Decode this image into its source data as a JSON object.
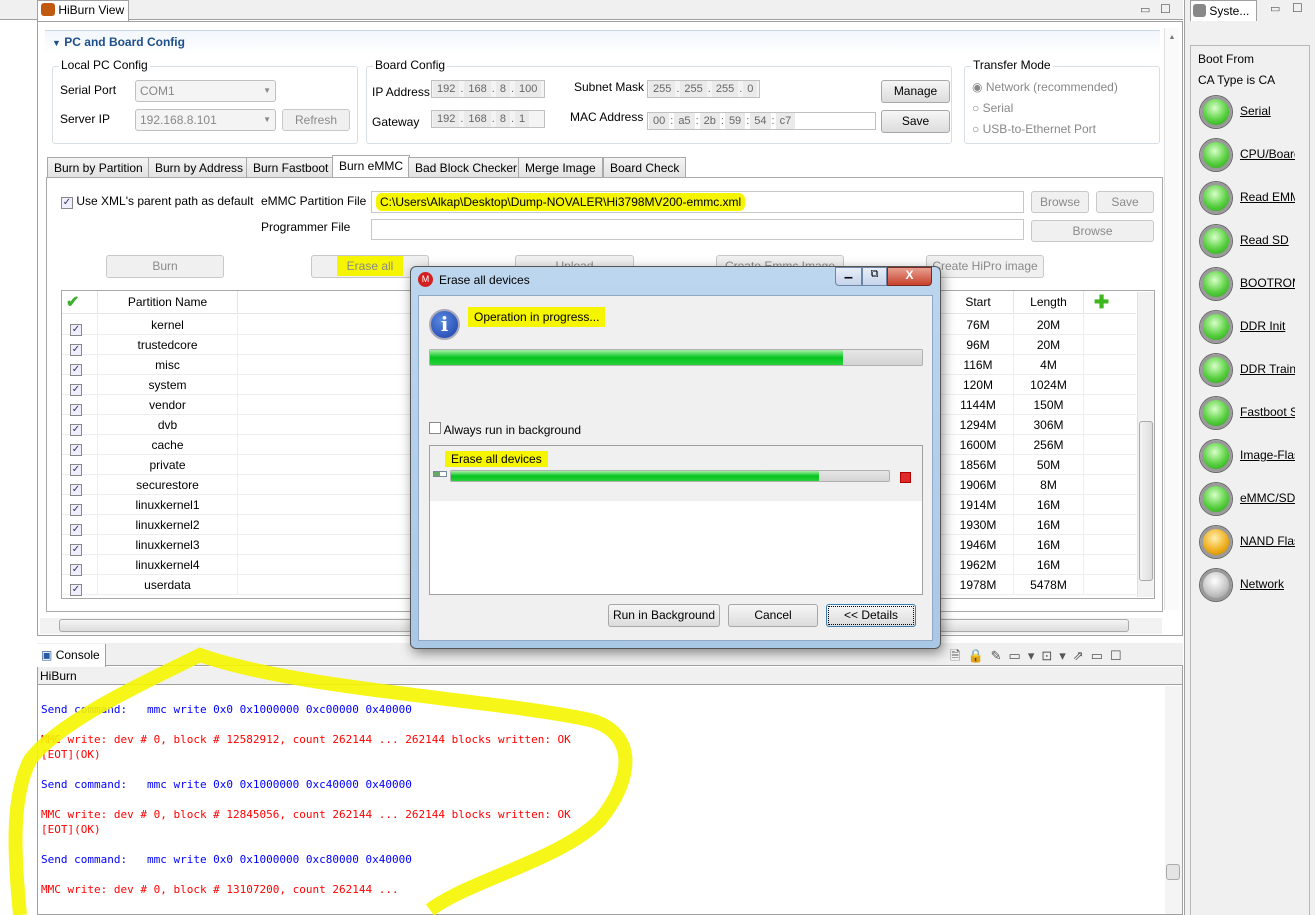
{
  "view_tab": {
    "title": "HiBurn View"
  },
  "section": {
    "title": "PC and Board Config"
  },
  "local_pc": {
    "title": "Local PC Config",
    "serial_port_label": "Serial Port",
    "serial_port_value": "COM1",
    "server_ip_label": "Server IP",
    "server_ip_value": "192.168.8.101",
    "refresh": "Refresh"
  },
  "board": {
    "title": "Board Config",
    "ip_label": "IP Address",
    "ip": [
      "192",
      "168",
      "8",
      "100"
    ],
    "gateway_label": "Gateway",
    "gateway": [
      "192",
      "168",
      "8",
      "1"
    ],
    "subnet_label": "Subnet Mask",
    "subnet": [
      "255",
      "255",
      "255",
      "0"
    ],
    "mac_label": "MAC Address",
    "mac": [
      "00",
      "a5",
      "2b",
      "59",
      "54",
      "c7"
    ],
    "manage": "Manage",
    "save": "Save"
  },
  "transfer": {
    "title": "Transfer Mode",
    "options": [
      "Network (recommended)",
      "Serial",
      "USB-to-Ethernet Port"
    ],
    "selected": 0
  },
  "tabs": [
    "Burn by Partition",
    "Burn by Address",
    "Burn Fastboot",
    "Burn eMMC",
    "Bad Block Checker",
    "Merge Image",
    "Board Check"
  ],
  "active_tab": "Burn eMMC",
  "emmc": {
    "use_parent_label": "Use XML's parent path as default",
    "use_parent_checked": true,
    "partition_file_label": "eMMC Partition File",
    "partition_file": "C:\\Users\\Alkap\\Desktop\\Dump-NOVALER\\Hi3798MV200-emmc.xml",
    "programmer_label": "Programmer File",
    "programmer_file": "",
    "browse": "Browse",
    "save": "Save",
    "burn": "Burn",
    "erase_all": "Erase all",
    "upload": "Upload",
    "create_emmc": "Create Emmc Image",
    "create_hipro": "Create HiPro image"
  },
  "table": {
    "headers": {
      "name": "Partition Name",
      "start": "Start",
      "length": "Length"
    },
    "rows": [
      {
        "name": "kernel",
        "start": "76M",
        "length": "20M"
      },
      {
        "name": "trustedcore",
        "start": "96M",
        "length": "20M"
      },
      {
        "name": "misc",
        "start": "116M",
        "length": "4M"
      },
      {
        "name": "system",
        "start": "120M",
        "length": "1024M"
      },
      {
        "name": "vendor",
        "start": "1144M",
        "length": "150M"
      },
      {
        "name": "dvb",
        "start": "1294M",
        "length": "306M"
      },
      {
        "name": "cache",
        "start": "1600M",
        "length": "256M"
      },
      {
        "name": "private",
        "start": "1856M",
        "length": "50M"
      },
      {
        "name": "securestore",
        "start": "1906M",
        "length": "8M"
      },
      {
        "name": "linuxkernel1",
        "start": "1914M",
        "length": "16M"
      },
      {
        "name": "linuxkernel2",
        "start": "1930M",
        "length": "16M"
      },
      {
        "name": "linuxkernel3",
        "start": "1946M",
        "length": "16M"
      },
      {
        "name": "linuxkernel4",
        "start": "1962M",
        "length": "16M"
      },
      {
        "name": "userdata",
        "start": "1978M",
        "length": "5478M"
      }
    ]
  },
  "dialog": {
    "title": "Erase all devices",
    "message": "Operation in progress...",
    "progress": 0.84,
    "always_bg": "Always run in background",
    "task_name": "Erase all devices",
    "task_progress": 0.84,
    "run_bg": "Run in Background",
    "cancel": "Cancel",
    "details": "<< Details"
  },
  "console": {
    "tab": "Console",
    "name": "HiBurn",
    "lines": [
      {
        "text": "Send command:   mmc write 0x0 0x1000000 0xc00000 0x40000",
        "color": "blue"
      },
      {
        "text": "MMC write: dev # 0, block # 12582912, count 262144 ... 262144 blocks written: OK",
        "color": "red"
      },
      {
        "text": "[EOT](OK)",
        "color": "red"
      },
      {
        "text": "Send command:   mmc write 0x0 0x1000000 0xc40000 0x40000",
        "color": "blue"
      },
      {
        "text": "MMC write: dev # 0, block # 12845056, count 262144 ... 262144 blocks written: OK",
        "color": "red"
      },
      {
        "text": "[EOT](OK)",
        "color": "red"
      },
      {
        "text": "Send command:   mmc write 0x0 0x1000000 0xc80000 0x40000",
        "color": "blue"
      },
      {
        "text": "MMC write: dev # 0, block # 13107200, count 262144 ...",
        "color": "red"
      }
    ]
  },
  "system": {
    "tab": "Syste...",
    "boot_from": "Boot From",
    "ca_type": "CA Type is  CA",
    "indicators": [
      {
        "label": "Serial",
        "status": "green"
      },
      {
        "label": "CPU/Board",
        "status": "green"
      },
      {
        "label": "Read EMMC",
        "status": "green"
      },
      {
        "label": "Read SD",
        "status": "green"
      },
      {
        "label": "BOOTROM",
        "status": "green"
      },
      {
        "label": "DDR Init",
        "status": "green"
      },
      {
        "label": "DDR Training",
        "status": "green"
      },
      {
        "label": "Fastboot S",
        "status": "green"
      },
      {
        "label": "Image-Flash",
        "status": "green"
      },
      {
        "label": "eMMC/SD",
        "status": "green"
      },
      {
        "label": "NAND Flash",
        "status": "orange"
      },
      {
        "label": "Network",
        "status": "gray"
      }
    ]
  },
  "colors": {
    "green": "#4fc83a",
    "orange": "#f0b020",
    "gray": "#c8c8c8",
    "highlight": "#f5f500",
    "console_blue": "#0000ff",
    "console_red": "#ff0000"
  }
}
